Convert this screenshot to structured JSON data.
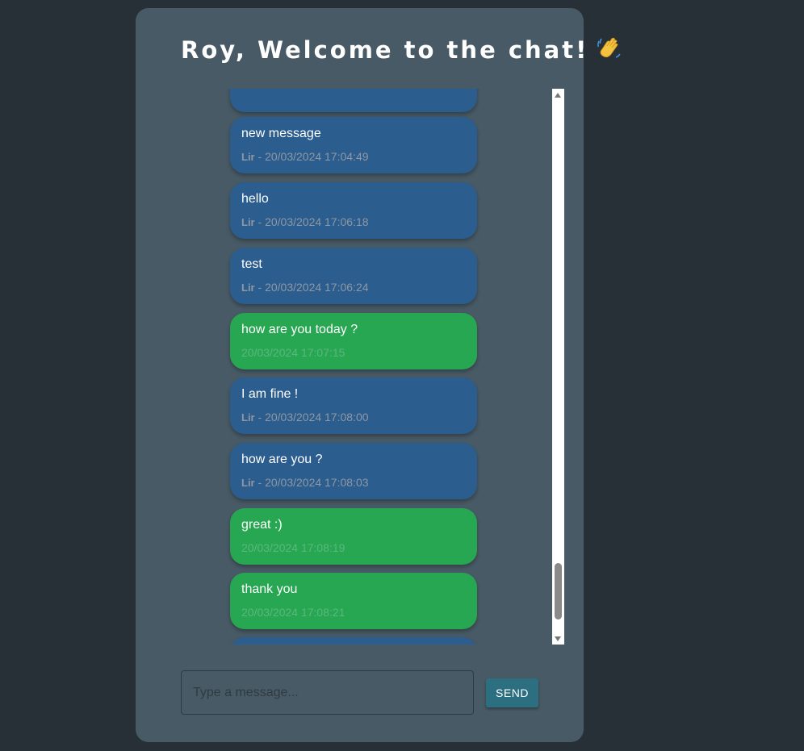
{
  "header": {
    "title": "Roy, Welcome to the chat!"
  },
  "messages": [
    {
      "text": "",
      "sender": "",
      "timestamp": "",
      "own": false
    },
    {
      "text": "new message",
      "sender": "Lir",
      "timestamp": " - 20/03/2024 17:04:49",
      "own": false
    },
    {
      "text": "hello",
      "sender": "Lir",
      "timestamp": " - 20/03/2024 17:06:18",
      "own": false
    },
    {
      "text": "test",
      "sender": "Lir",
      "timestamp": " - 20/03/2024 17:06:24",
      "own": false
    },
    {
      "text": "how are you today ?",
      "sender": "",
      "timestamp": "20/03/2024 17:07:15",
      "own": true
    },
    {
      "text": "I am fine !",
      "sender": "Lir",
      "timestamp": " - 20/03/2024 17:08:00",
      "own": false
    },
    {
      "text": "how are you ?",
      "sender": "Lir",
      "timestamp": " - 20/03/2024 17:08:03",
      "own": false
    },
    {
      "text": "great :)",
      "sender": "",
      "timestamp": "20/03/2024 17:08:19",
      "own": true
    },
    {
      "text": "thank you",
      "sender": "",
      "timestamp": "20/03/2024 17:08:21",
      "own": true
    },
    {
      "text": ":)",
      "sender": "",
      "timestamp": "",
      "own": false
    }
  ],
  "composer": {
    "placeholder": "Type a message...",
    "value": "",
    "send_label": "SEND"
  },
  "colors": {
    "page_background": "#273036",
    "card_background": "#485a65",
    "other_bubble": "#2b5d8f",
    "own_bubble": "#28a753",
    "send_button": "#2b6f81"
  }
}
